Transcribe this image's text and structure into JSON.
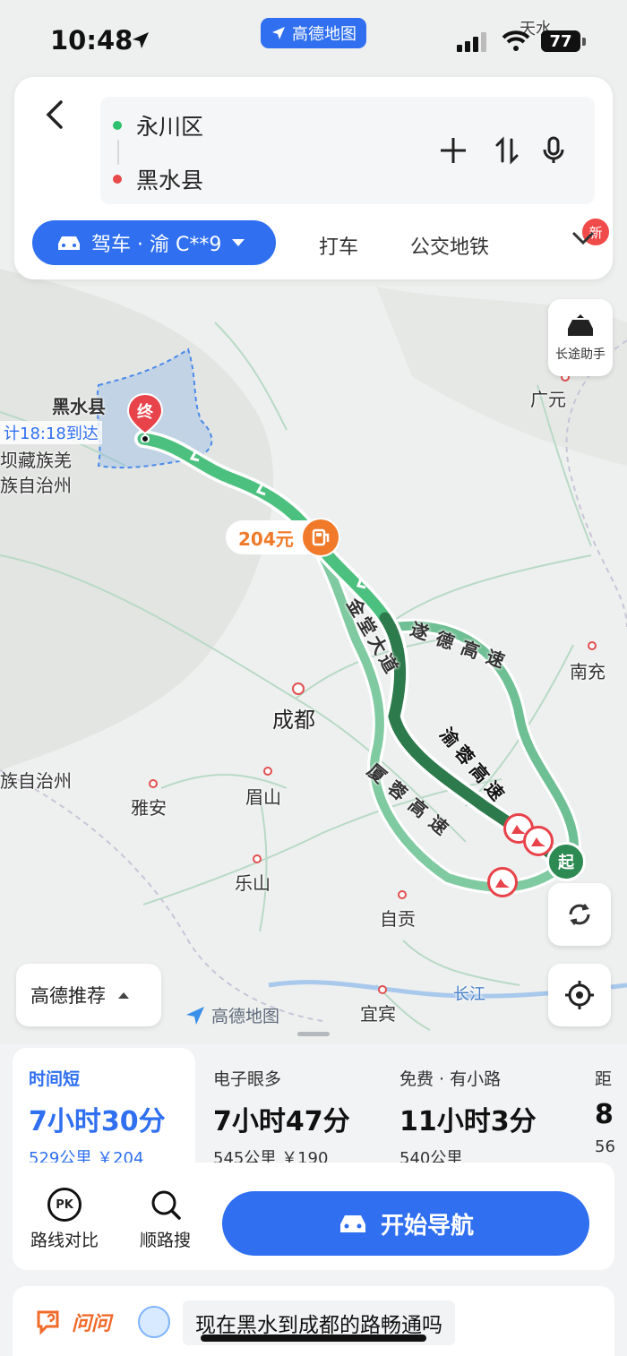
{
  "status_bar": {
    "time": "10:48",
    "app_name": "高德地图",
    "battery": "77"
  },
  "route_inputs": {
    "origin": "永川区",
    "destination": "黑水县"
  },
  "modes": {
    "drive": "驾车 · 渝 C**9",
    "taxi": "打车",
    "transit": "公交地铁",
    "new_badge": "新"
  },
  "long_trip_helper": "长途助手",
  "map": {
    "top_label": "天水",
    "dest_name": "黑水县",
    "arrival": "计18:18到达",
    "dest_pin": "终",
    "start_pin": "起",
    "toll_price": "204元",
    "region_1": "坝藏族羌",
    "region_2": "族自治州",
    "region_3": "族自治州",
    "cities": {
      "guangyuan": "广元",
      "nanchong": "南充",
      "chengdu": "成都",
      "meishan": "眉山",
      "yaan": "雅安",
      "leshan": "乐山",
      "zigong": "自贡",
      "yibin": "宜宾",
      "changjiang": "长江"
    },
    "roads": {
      "jintang": "金堂大道",
      "suide": "遂德高速",
      "yurong": "渝蓉高速",
      "xiarong": "厦蓉高速"
    }
  },
  "recommend": "高德推荐",
  "watermark": "高德地图",
  "routes": [
    {
      "tag": "时间短",
      "duration": "7小时30分",
      "meta": "529公里 ￥204"
    },
    {
      "tag": "电子眼多",
      "duration": "7小时47分",
      "meta": "545公里 ￥190"
    },
    {
      "tag": "免费 · 有小路",
      "duration": "11小时3分",
      "meta": "540公里"
    },
    {
      "tag": "距",
      "duration": "8",
      "meta": "56"
    }
  ],
  "actions": {
    "compare": "路线对比",
    "along_search": "顺路搜",
    "start_nav": "开始导航",
    "pk": "PK"
  },
  "ask": {
    "label": "问问",
    "question": "现在黑水到成都的路畅通吗"
  },
  "colors": {
    "accent": "#2f6ff0",
    "route_main": "#2d8a52",
    "route_alt": "#7fcaa0",
    "toll": "#f07a2a"
  }
}
